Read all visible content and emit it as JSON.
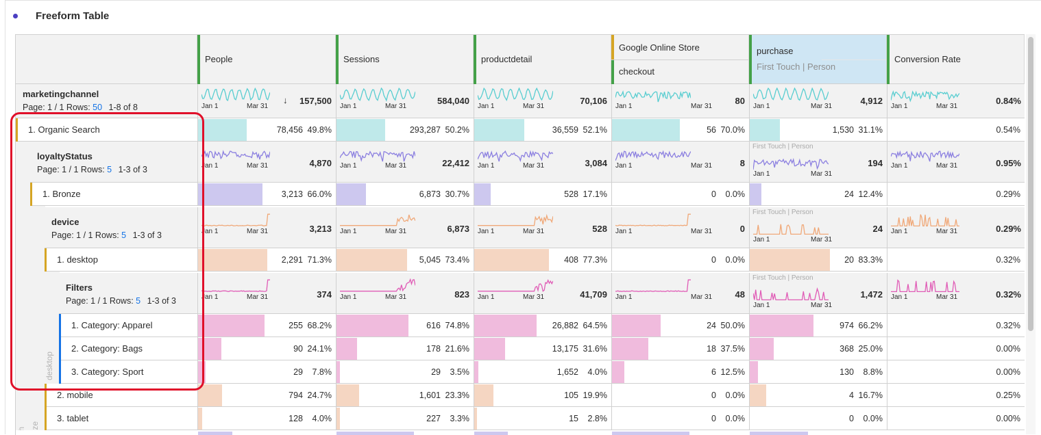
{
  "title": "Freeform Table",
  "colors": {
    "accent": "#4b3fc2",
    "link": "#1473e6",
    "highlight": "#e0102a",
    "bar_cyan": "#bfe9ea",
    "bar_purple": "#cdc8ef",
    "bar_orange": "#f5d6c2",
    "bar_pink": "#f0bbdd",
    "spark_cyan": "#58cdd0",
    "spark_purple": "#8b7fe0",
    "spark_orange": "#f0a878",
    "spark_pink": "#e05cb6"
  },
  "columns": [
    {
      "label": "People"
    },
    {
      "label": "Sessions"
    },
    {
      "label": "productdetail"
    },
    {
      "label": "Google Online Store",
      "sublabel": "checkout"
    },
    {
      "label": "purchase",
      "sublabel": "First Touch | Person"
    },
    {
      "label": "Conversion Rate"
    }
  ],
  "axis": {
    "start": "Jan 1",
    "end": "Mar 31"
  },
  "first_touch_label": "First Touch | Person",
  "sort_icon": "arrow-down-icon",
  "groups": [
    {
      "name": "marketingchannel",
      "page": "Page: 1 / 1 Rows:",
      "rows": "50",
      "range": "1-8 of 8",
      "totals": [
        "157,500",
        "584,040",
        "70,106",
        "80",
        "4,912",
        "0.84%"
      ]
    },
    {
      "name": "loyaltyStatus",
      "page": "Page: 1 / 1 Rows:",
      "rows": "5",
      "range": "1-3 of 3",
      "totals": [
        "4,870",
        "22,412",
        "3,084",
        "8",
        "194",
        "0.95%"
      ]
    },
    {
      "name": "device",
      "page": "Page: 1 / 1 Rows:",
      "rows": "5",
      "range": "1-3 of 3",
      "totals": [
        "3,213",
        "6,873",
        "528",
        "0",
        "24",
        "0.29%"
      ]
    },
    {
      "name": "Filters",
      "page": "Page: 1 / 1 Rows:",
      "rows": "5",
      "range": "1-3 of 3",
      "totals": [
        "374",
        "823",
        "41,709",
        "48",
        "1,472",
        "0.32%"
      ]
    }
  ],
  "rows": [
    {
      "label": "1. Organic Search",
      "vals": [
        [
          "78,456",
          "49.8%"
        ],
        [
          "293,287",
          "50.2%"
        ],
        [
          "36,559",
          "52.1%"
        ],
        [
          "56",
          "70.0%"
        ],
        [
          "1,530",
          "31.1%"
        ]
      ],
      "rate": "0.54%",
      "fills": [
        0.498,
        0.502,
        0.521,
        0.7,
        0.311
      ]
    },
    {
      "label": "1. Bronze",
      "vals": [
        [
          "3,213",
          "66.0%"
        ],
        [
          "6,873",
          "30.7%"
        ],
        [
          "528",
          "17.1%"
        ],
        [
          "0",
          "0.0%"
        ],
        [
          "24",
          "12.4%"
        ]
      ],
      "rate": "0.29%",
      "fills": [
        0.66,
        0.307,
        0.171,
        0,
        0.124
      ]
    },
    {
      "label": "1. desktop",
      "vals": [
        [
          "2,291",
          "71.3%"
        ],
        [
          "5,045",
          "73.4%"
        ],
        [
          "408",
          "77.3%"
        ],
        [
          "0",
          "0.0%"
        ],
        [
          "20",
          "83.3%"
        ]
      ],
      "rate": "0.32%",
      "fills": [
        0.713,
        0.734,
        0.773,
        0,
        0.833
      ]
    },
    {
      "label": "1. Category: Apparel",
      "vals": [
        [
          "255",
          "68.2%"
        ],
        [
          "616",
          "74.8%"
        ],
        [
          "26,882",
          "64.5%"
        ],
        [
          "24",
          "50.0%"
        ],
        [
          "974",
          "66.2%"
        ]
      ],
      "rate": "0.32%",
      "fills": [
        0.682,
        0.748,
        0.645,
        0.5,
        0.662
      ]
    },
    {
      "label": "2. Category: Bags",
      "vals": [
        [
          "90",
          "24.1%"
        ],
        [
          "178",
          "21.6%"
        ],
        [
          "13,175",
          "31.6%"
        ],
        [
          "18",
          "37.5%"
        ],
        [
          "368",
          "25.0%"
        ]
      ],
      "rate": "0.00%",
      "fills": [
        0.241,
        0.216,
        0.316,
        0.375,
        0.25
      ]
    },
    {
      "label": "3. Category: Sport",
      "vals": [
        [
          "29",
          "7.8%"
        ],
        [
          "29",
          "3.5%"
        ],
        [
          "1,652",
          "4.0%"
        ],
        [
          "6",
          "12.5%"
        ],
        [
          "130",
          "8.8%"
        ]
      ],
      "rate": "0.00%",
      "fills": [
        0.078,
        0.035,
        0.04,
        0.125,
        0.088
      ]
    },
    {
      "label": "2. mobile",
      "vals": [
        [
          "794",
          "24.7%"
        ],
        [
          "1,601",
          "23.3%"
        ],
        [
          "105",
          "19.9%"
        ],
        [
          "0",
          "0.0%"
        ],
        [
          "4",
          "16.7%"
        ]
      ],
      "rate": "0.25%",
      "fills": [
        0.247,
        0.233,
        0.199,
        0,
        0.167
      ]
    },
    {
      "label": "3. tablet",
      "vals": [
        [
          "128",
          "4.0%"
        ],
        [
          "227",
          "3.3%"
        ],
        [
          "15",
          "2.8%"
        ],
        [
          "0",
          "0.0%"
        ],
        [
          "0",
          "0.0%"
        ]
      ],
      "rate": "0.00%",
      "fills": [
        0.04,
        0.033,
        0.028,
        0,
        0
      ]
    }
  ],
  "vertical_labels": {
    "desktop": "desktop",
    "bronze": "Bronze",
    "search": "earch"
  }
}
